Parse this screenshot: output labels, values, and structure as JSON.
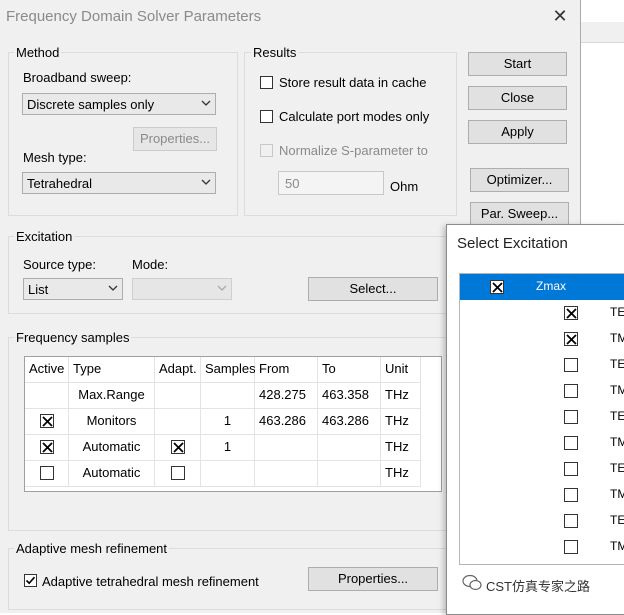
{
  "dialog": {
    "title": "Frequency Domain Solver Parameters",
    "close_glyph": "✕"
  },
  "method": {
    "legend": "Method",
    "broadband_label": "Broadband sweep:",
    "broadband_value": "Discrete samples only",
    "properties_button": "Properties...",
    "mesh_label": "Mesh type:",
    "mesh_value": "Tetrahedral"
  },
  "results": {
    "legend": "Results",
    "store_label": "Store result data in cache",
    "store_checked": false,
    "port_modes_label": "Calculate port modes only",
    "port_modes_checked": false,
    "normalize_label": "Normalize S-parameter to",
    "normalize_checked": false,
    "normalize_value": "50",
    "normalize_unit": "Ohm"
  },
  "actions": {
    "start": "Start",
    "close": "Close",
    "apply": "Apply",
    "optimizer": "Optimizer...",
    "par_sweep": "Par. Sweep..."
  },
  "excitation": {
    "legend": "Excitation",
    "source_label": "Source type:",
    "source_value": "List",
    "mode_label": "Mode:",
    "mode_value": "",
    "select_button": "Select..."
  },
  "frequency": {
    "legend": "Frequency samples",
    "columns": [
      "Active",
      "Type",
      "Adapt.",
      "Samples",
      "From",
      "To",
      "Unit"
    ],
    "rows": [
      {
        "active": null,
        "type": "Max.Range",
        "adapt": null,
        "samples": "",
        "from": "428.275",
        "to": "463.358",
        "unit": "THz"
      },
      {
        "active": true,
        "type": "Monitors",
        "adapt": null,
        "samples": "1",
        "from": "463.286",
        "to": "463.286",
        "unit": "THz"
      },
      {
        "active": true,
        "type": "Automatic",
        "adapt": true,
        "samples": "1",
        "from": "",
        "to": "",
        "unit": "THz"
      },
      {
        "active": false,
        "type": "Automatic",
        "adapt": false,
        "samples": "",
        "from": "",
        "to": "",
        "unit": "THz"
      }
    ]
  },
  "adaptive": {
    "legend": "Adaptive mesh refinement",
    "checkbox_label": "Adaptive tetrahedral mesh refinement",
    "checked": true,
    "properties_button": "Properties..."
  },
  "popup": {
    "title": "Select Excitation",
    "items": [
      {
        "label": "Zmax",
        "checked": true,
        "selected": true,
        "indent": false
      },
      {
        "label": "TE",
        "checked": true,
        "indent": true
      },
      {
        "label": "TM",
        "checked": true,
        "indent": true
      },
      {
        "label": "TE",
        "checked": false,
        "indent": true
      },
      {
        "label": "TM",
        "checked": false,
        "indent": true
      },
      {
        "label": "TE",
        "checked": false,
        "indent": true
      },
      {
        "label": "TM",
        "checked": false,
        "indent": true
      },
      {
        "label": "TE",
        "checked": false,
        "indent": true
      },
      {
        "label": "TM",
        "checked": false,
        "indent": true
      },
      {
        "label": "TE",
        "checked": false,
        "indent": true
      },
      {
        "label": "TM",
        "checked": false,
        "indent": true
      }
    ]
  },
  "watermark": "CST仿真专家之路",
  "colors": {
    "dialog_bg": "#f0f0f0",
    "selection": "#0078d7",
    "disabled_text": "#8a8a8a"
  }
}
